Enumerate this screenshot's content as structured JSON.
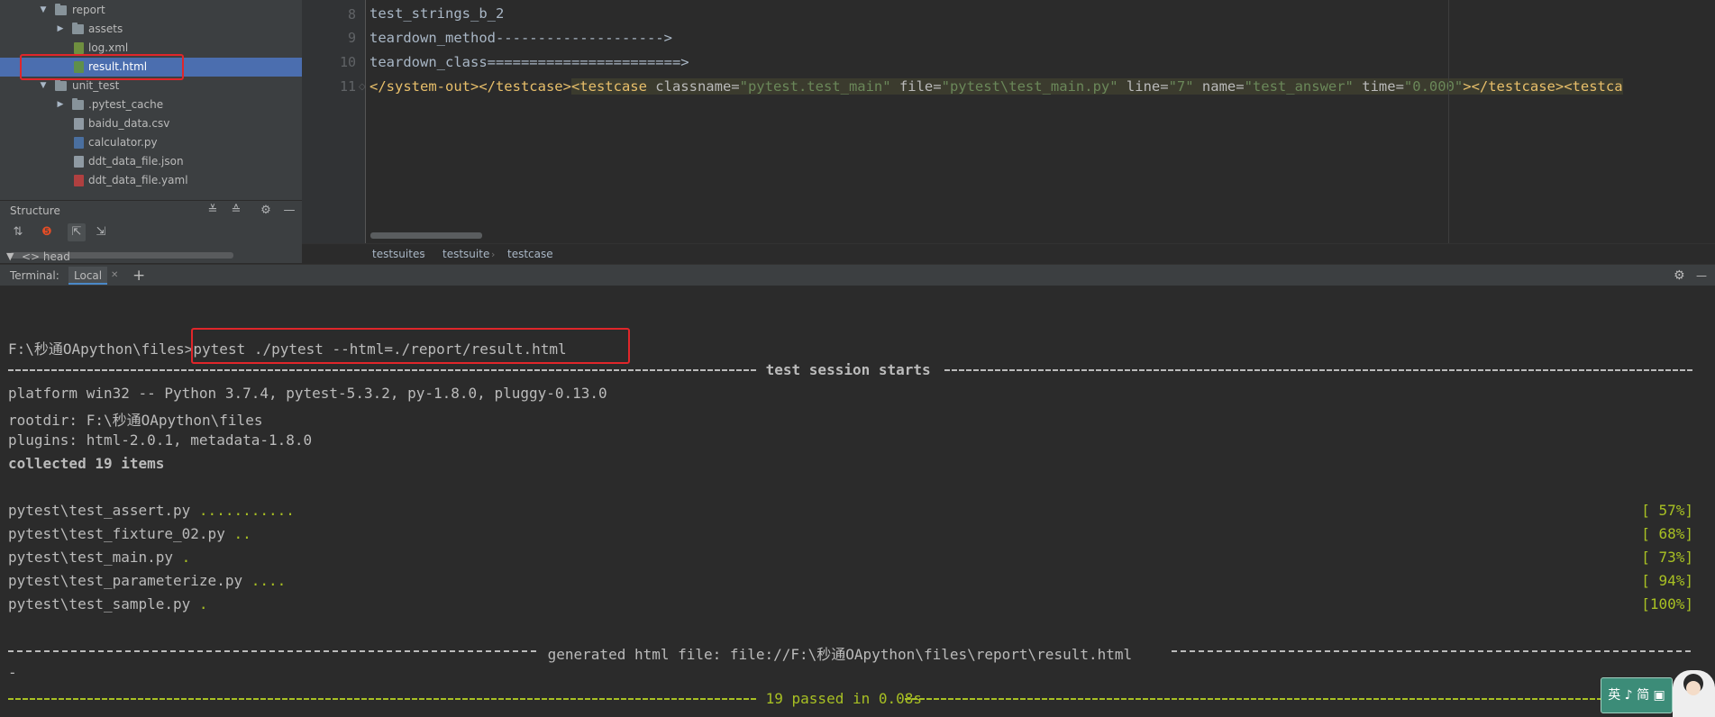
{
  "project_tree": {
    "items": [
      {
        "label": "report",
        "type": "folder",
        "expanded": true
      },
      {
        "label": "assets",
        "type": "folder",
        "expanded": false
      },
      {
        "label": "log.xml",
        "type": "file"
      },
      {
        "label": "result.html",
        "type": "file",
        "selected": true
      },
      {
        "label": "unit_test",
        "type": "folder",
        "expanded": true
      },
      {
        "label": ".pytest_cache",
        "type": "folder",
        "expanded": false
      },
      {
        "label": "baidu_data.csv",
        "type": "file"
      },
      {
        "label": "calculator.py",
        "type": "file"
      },
      {
        "label": "ddt_data_file.json",
        "type": "file"
      },
      {
        "label": "ddt_data_file.yaml",
        "type": "file"
      }
    ]
  },
  "structure": {
    "title": "Structure",
    "tree_item": "<> head"
  },
  "editor": {
    "lines": [
      {
        "num": "8",
        "text": "test_strings_b_2"
      },
      {
        "num": "9",
        "text": "teardown_method-------------------->"
      },
      {
        "num": "10",
        "text": "teardown_class=======================>"
      },
      {
        "num": "11"
      }
    ],
    "line11": {
      "close_tags": "</system-out></testcase>",
      "tag_open": "<testcase",
      "attr_classname": " classname=",
      "val_classname": "\"pytest.test_main\"",
      "attr_file": " file=",
      "val_file": "\"pytest\\test_main.py\"",
      "attr_line": " line=",
      "val_line": "\"7\"",
      "attr_name": " name=",
      "val_name": "\"test_answer\"",
      "attr_time": " time=",
      "val_time": "\"0.000\"",
      "tail": "></testcase><testca"
    }
  },
  "breadcrumb": [
    "testsuites",
    "testsuite",
    "testcase"
  ],
  "terminal": {
    "label": "Terminal:",
    "tab": "Local",
    "add": "+",
    "prompt": "F:\\秒通OApython\\files>",
    "command": "pytest ./pytest --html=./report/result.html",
    "session_title": " test session starts ",
    "platform": "platform win32 -- Python 3.7.4, pytest-5.3.2, py-1.8.0, pluggy-0.13.0",
    "rootdir": "rootdir: F:\\秒通OApython\\files",
    "plugins": "plugins: html-2.0.1, metadata-1.8.0",
    "collected": "collected 19 items",
    "results": [
      {
        "file": "pytest\\test_assert.py ",
        "dots": "...........",
        "pct": "[ 57%]"
      },
      {
        "file": "pytest\\test_fixture_02.py ",
        "dots": "..",
        "pct": "[ 68%]"
      },
      {
        "file": "pytest\\test_main.py ",
        "dots": ".",
        "pct": "[ 73%]"
      },
      {
        "file": "pytest\\test_parameterize.py ",
        "dots": "....",
        "pct": "[ 94%]"
      },
      {
        "file": "pytest\\test_sample.py ",
        "dots": ".",
        "pct": "[100%]"
      }
    ],
    "generated": " generated html file: file://F:\\秒通OApython\\files\\report\\result.html ",
    "wrap_char": "-",
    "summary": " 19 passed in 0.08s "
  },
  "sticker": {
    "text": "英 ♪ 简 ▣"
  }
}
